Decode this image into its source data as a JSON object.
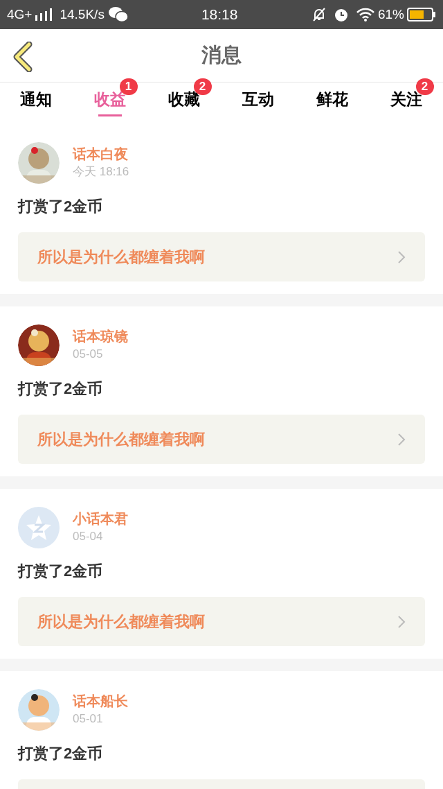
{
  "status_bar": {
    "network": "4G+",
    "speed": "14.5K/s",
    "time": "18:18",
    "battery": "61%"
  },
  "header": {
    "title": "消息"
  },
  "tabs": [
    {
      "label": "通知",
      "selected": false
    },
    {
      "label": "收益",
      "selected": true,
      "badge": "1"
    },
    {
      "label": "收藏",
      "selected": false,
      "badge": "2"
    },
    {
      "label": "互动",
      "selected": false
    },
    {
      "label": "鲜花",
      "selected": false
    },
    {
      "label": "关注",
      "selected": false,
      "badge": "2"
    }
  ],
  "messages": [
    {
      "name": "话本白夜",
      "time": "今天 18:16",
      "text": "打赏了2金币",
      "link": "所以是为什么都缠着我啊"
    },
    {
      "name": "话本琼镜",
      "time": "05-05",
      "text": "打赏了2金币",
      "link": "所以是为什么都缠着我啊"
    },
    {
      "avatar": {
        "kind": "default"
      },
      "name": "小话本君",
      "time": "05-04",
      "text": "打赏了2金币",
      "link": "所以是为什么都缠着我啊"
    },
    {
      "name": "话本船长",
      "time": "05-01",
      "text": "打赏了2金币"
    }
  ]
}
